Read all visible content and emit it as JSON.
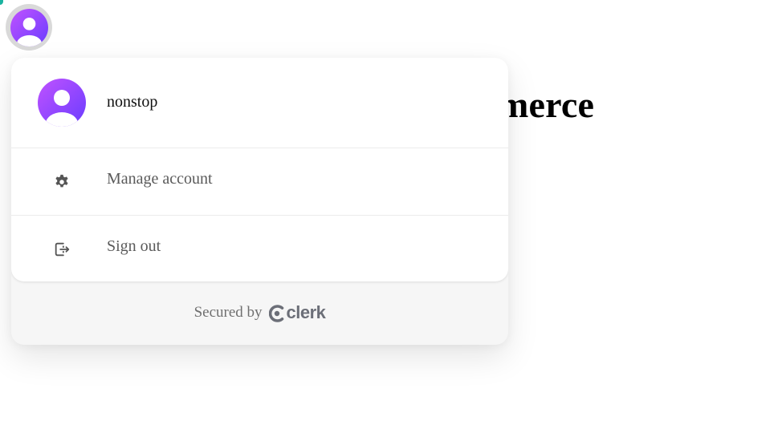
{
  "header": {
    "avatar_icon": "default-user-avatar-icon",
    "heading_text": "merce"
  },
  "user_menu": {
    "user": {
      "username": "nonstop",
      "avatar_icon": "default-user-avatar-icon"
    },
    "items": [
      {
        "label": "Manage account",
        "icon": "gear-icon"
      },
      {
        "label": "Sign out",
        "icon": "sign-out-icon"
      }
    ],
    "footer": {
      "secured_by_label": "Secured by",
      "brand": "clerk",
      "brand_icon": "clerk-logo-icon"
    }
  },
  "colors": {
    "avatar_gradient_start": "#c052ff",
    "avatar_gradient_end": "#6a3dff",
    "avatar_ring": "#d9d9d9",
    "accent": "#1bb3a0",
    "menu_text": "#5a5a5a",
    "footer_bg": "#f6f6f6",
    "clerk_brand": "#6c6f78"
  }
}
